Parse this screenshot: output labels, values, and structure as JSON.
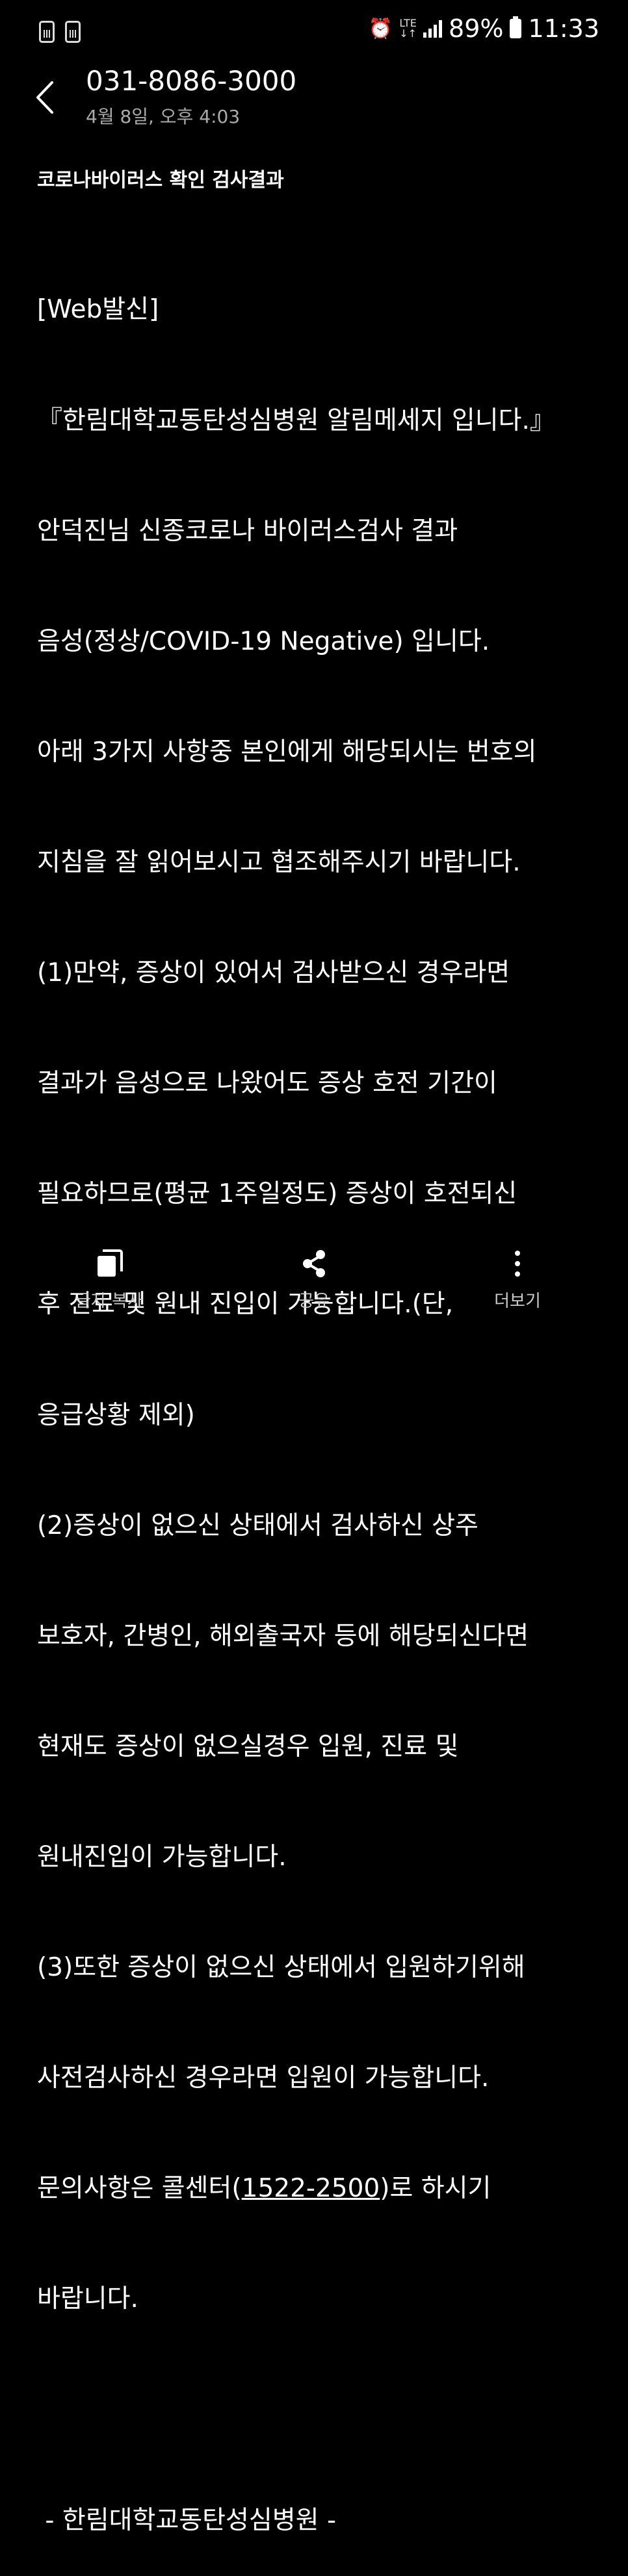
{
  "status_bar": {
    "battery": "89%",
    "time": "11:33",
    "network": "LTE"
  },
  "header": {
    "title": "031-8086-3000",
    "subtitle": "4월 8일, 오후 4:03"
  },
  "message": {
    "subject": "코로나바이러스 확인 검사결과",
    "lines": [
      "[Web발신]",
      "『한림대학교동탄성심병원 알림메세지 입니다.』",
      "안덕진님 신종코로나 바이러스검사 결과",
      "음성(정상/COVID-19 Negative) 입니다.",
      "아래 3가지 사항중 본인에게 해당되시는 번호의",
      "지침을 잘 읽어보시고 협조해주시기 바랍니다.",
      "(1)만약, 증상이 있어서 검사받으신 경우라면",
      "결과가 음성으로 나왔어도 증상 호전 기간이",
      "필요하므로(평균 1주일정도) 증상이 호전되신",
      "후 진료 및 원내 진입이 가능합니다.(단,",
      "응급상황 제외)",
      "(2)증상이 없으신 상태에서 검사하신 상주",
      "보호자, 간병인, 해외출국자 등에 해당되신다면",
      "현재도 증상이 없으실경우 입원, 진료 및",
      "원내진입이 가능합니다.",
      "(3)또한 증상이 없으신 상태에서 입원하기위해",
      "사전검사하신 경우라면 입원이 가능합니다."
    ],
    "contact_prefix": "문의사항은 콜센터(",
    "contact_phone": "1522-2500",
    "contact_suffix": ")로 하시기",
    "contact_line2": "바랍니다.",
    "blank": "",
    "signature": " - 한림대학교동탄성심병원 -"
  },
  "bottom_bar": {
    "copy_label": "글자 복사",
    "share_label": "공유",
    "more_label": "더보기"
  }
}
